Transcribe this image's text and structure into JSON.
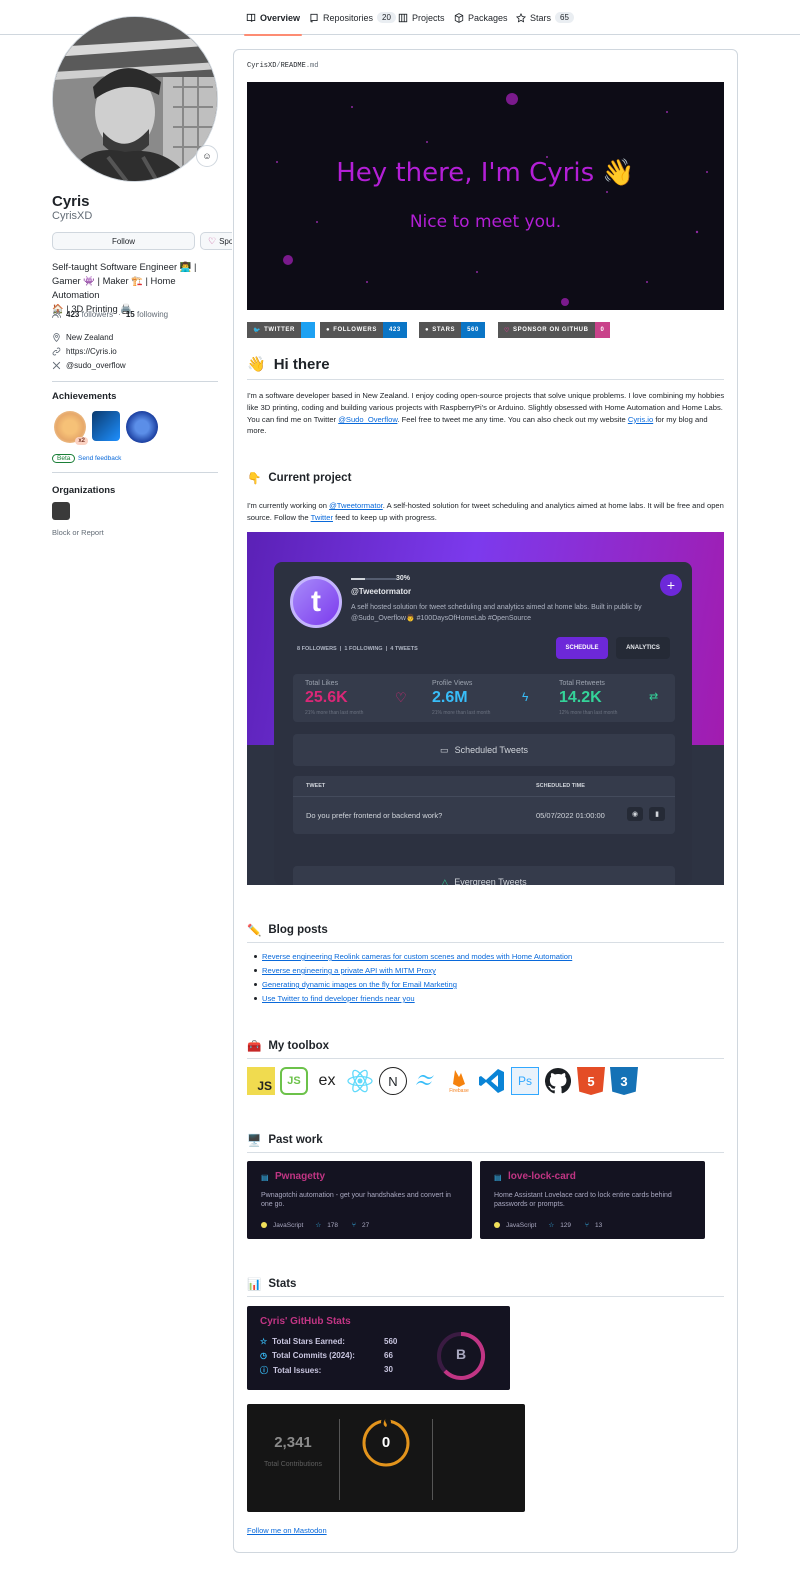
{
  "nav": {
    "tabs": [
      {
        "label": "Overview",
        "count": ""
      },
      {
        "label": "Repositories",
        "count": "20"
      },
      {
        "label": "Projects",
        "count": ""
      },
      {
        "label": "Packages",
        "count": ""
      },
      {
        "label": "Stars",
        "count": "65"
      }
    ]
  },
  "profile": {
    "name": "Cyris",
    "login": "CyrisXD",
    "follow_label": "Follow",
    "sponsor_label": "Sponsor",
    "bio_lines": [
      "Self-taught Software Engineer 👨‍💻 |",
      "Gamer 👾 | Maker 🏗️ | Home Automation",
      "🏠 | 3D Printing 🖨️"
    ],
    "followers_count": "423",
    "followers_label": "followers",
    "following_count": "15",
    "following_label": "following",
    "location": "New Zealand",
    "website": "https://Cyris.io",
    "social": "@sudo_overflow",
    "achievements_title": "Achievements",
    "achievement_multiplier": "x2",
    "beta_label": "Beta",
    "feedback_label": "Send feedback",
    "organizations_title": "Organizations",
    "block_label": "Block or Report"
  },
  "readme": {
    "path_owner": "CyrisXD",
    "path_sep": "/",
    "path_file": "README",
    "path_ext": ".md",
    "hero_title": "Hey there, I'm Cyris 👋",
    "hero_subtitle": "Nice to meet you.",
    "shields": [
      {
        "label": "TWITTER",
        "value": "",
        "color": "#1da1f2"
      },
      {
        "label": "FOLLOWERS",
        "value": "423",
        "color": "#0a75c6"
      },
      {
        "label": "STARS",
        "value": "560",
        "color": "#0a75c6"
      },
      {
        "label": "SPONSOR ON GITHUB",
        "value": "0",
        "color": "#c9428a"
      }
    ],
    "hi_emoji": "👋",
    "hi_title": "Hi there",
    "intro_a": "I'm a software developer based in New Zealand. I enjoy coding open-source projects that solve unique problems. I love combining my hobbies like 3D printing, coding and building various projects with RaspberryPi's or Arduino. Slightly obsessed with Home Automation and Home Labs. You can find me on Twitter ",
    "intro_link1": "@Sudo_Overflow",
    "intro_b": ". Feel free to tweet me any time. You can also check out my website ",
    "intro_link2": "Cyris.io",
    "intro_c": " for my blog and more.",
    "current_emoji": "👇",
    "current_title": "Current project",
    "current_a": "I'm currently working on ",
    "current_link1": "@Tweetormator",
    "current_b": ". A self-hosted solution for tweet scheduling and analytics aimed at home labs. It will be free and open source. Follow the ",
    "current_link2": "Twitter",
    "current_c": " feed to keep up with progress.",
    "app": {
      "progress_pct": "30%",
      "progress_value": 0.3,
      "handle": "@Tweetormator",
      "desc": "A self hosted solution for tweet scheduling and analytics aimed at home labs. Built in public by @Sudo_Overflow👨 #100DaysOfHomeLab #OpenSource",
      "followers": "8 FOLLOWERS",
      "following": "1 FOLLOWING",
      "tweets": "4 TWEETS",
      "schedule_btn": "SCHEDULE",
      "analytics_btn": "ANALYTICS",
      "stats": [
        {
          "label": "Total Likes",
          "value": "25.6K",
          "sub": "21% more than last month",
          "color": "#db2777"
        },
        {
          "label": "Profile Views",
          "value": "2.6M",
          "sub": "21% more than last month",
          "color": "#38bdf8"
        },
        {
          "label": "Total Retweets",
          "value": "14.2K",
          "sub": "12% more than last month",
          "color": "#34d399"
        }
      ],
      "scheduled_title": "Scheduled Tweets",
      "col_tweet": "TWEET",
      "col_time": "SCHEDULED TIME",
      "row_tweet": "Do you prefer frontend or backend work?",
      "row_time": "05/07/2022 01:00:00",
      "evergreen_title": "Evergreen Tweets",
      "avatar_letter": "t"
    },
    "blog_emoji": "✏️",
    "blog_title": "Blog posts",
    "blog_posts": [
      "Reverse engineering Reolink cameras for custom scenes and modes with Home Automation",
      "Reverse engineering a private API with MITM Proxy",
      "Generating dynamic images on the fly for Email Marketing",
      "Use Twitter to find developer friends near you"
    ],
    "toolbox_emoji": "🧰",
    "toolbox_title": "My toolbox",
    "tools": [
      {
        "icon": "javascript-icon",
        "text": "JS"
      },
      {
        "icon": "nodejs-icon",
        "text": "JS"
      },
      {
        "icon": "express-icon",
        "text": "ex"
      },
      {
        "icon": "react-icon",
        "text": ""
      },
      {
        "icon": "nextjs-icon",
        "text": "N"
      },
      {
        "icon": "tailwind-icon",
        "text": ""
      },
      {
        "icon": "firebase-icon",
        "text": "Firebase"
      },
      {
        "icon": "vscode-icon",
        "text": ""
      },
      {
        "icon": "photoshop-icon",
        "text": "Ps"
      },
      {
        "icon": "github-icon",
        "text": ""
      },
      {
        "icon": "html5-icon",
        "text": "5"
      },
      {
        "icon": "css3-icon",
        "text": "3"
      }
    ],
    "pastwork_emoji": "🖥️",
    "pastwork_title": "Past work",
    "repos": [
      {
        "name": "Pwnagetty",
        "desc": "Pwnagotchi automation - get your handshakes and convert in one go.",
        "lang": "JavaScript",
        "stars": "178",
        "forks": "27"
      },
      {
        "name": "love-lock-card",
        "desc": "Home Assistant Lovelace card to lock entire cards behind passwords or prompts.",
        "lang": "JavaScript",
        "stars": "129",
        "forks": "13"
      }
    ],
    "stats_emoji": "📊",
    "stats_title": "Stats",
    "gh_stats": {
      "title": "Cyris' GitHub Stats",
      "rows": [
        {
          "label": "Total Stars Earned:",
          "value": "560"
        },
        {
          "label": "Total Commits (2024):",
          "value": "66"
        },
        {
          "label": "Total Issues:",
          "value": "30"
        }
      ],
      "grade": "B"
    },
    "streak": {
      "total": "2,341",
      "total_label": "Total Contributions",
      "current": "0"
    },
    "mastodon_link": "Follow me on Mastodon"
  },
  "colors": {
    "accent_tab": "#fd8c73",
    "link": "#0969da",
    "hero_text": "#b31fd6"
  }
}
